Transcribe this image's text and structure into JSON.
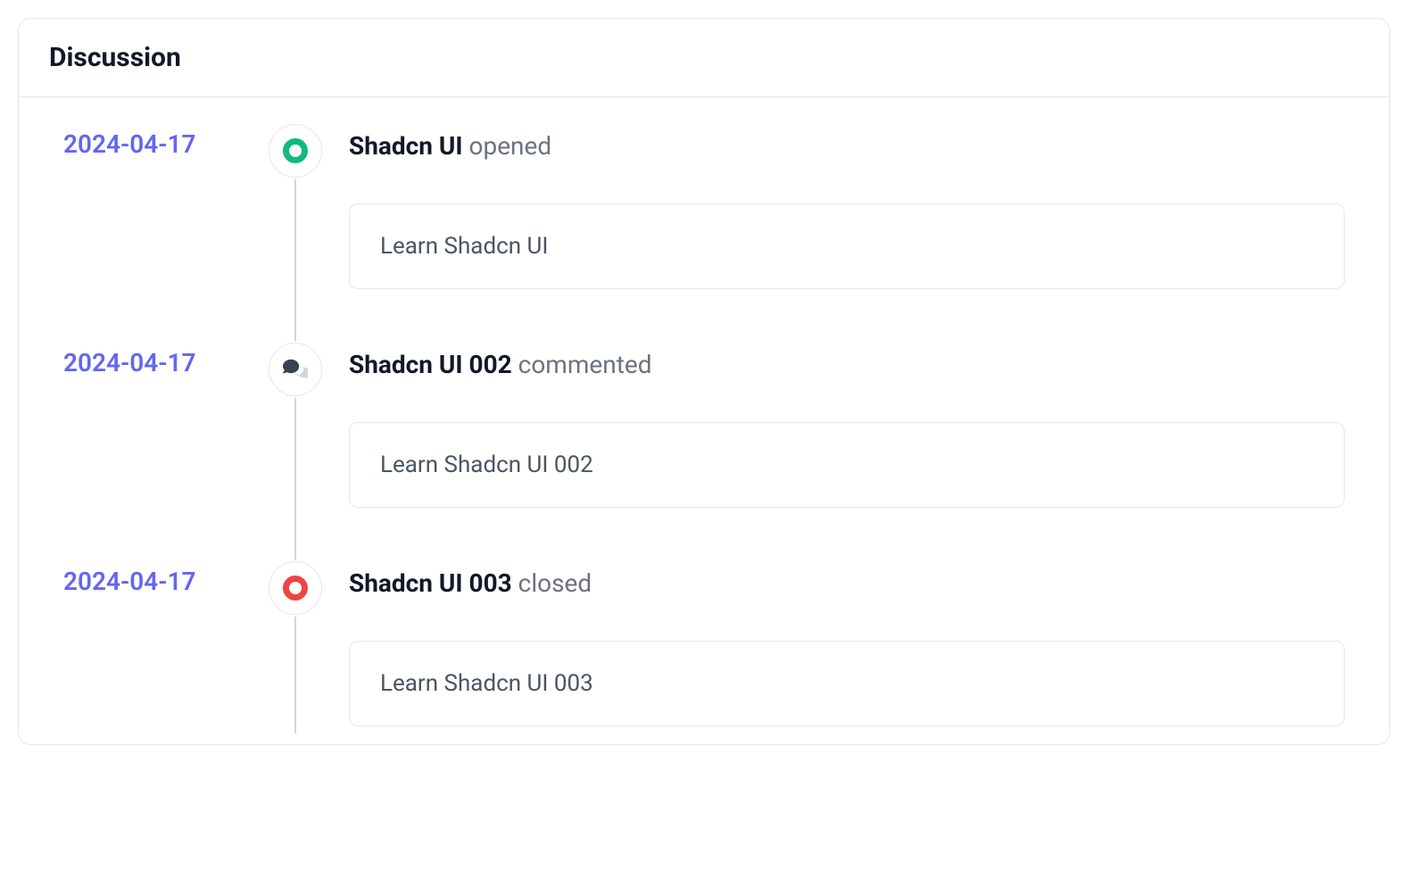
{
  "card": {
    "title": "Discussion"
  },
  "timeline": {
    "items": [
      {
        "date": "2024-04-17",
        "author": "Shadcn UI",
        "action": "opened",
        "body": "Learn Shadcn UI",
        "icon": "open"
      },
      {
        "date": "2024-04-17",
        "author": "Shadcn UI 002",
        "action": "commented",
        "body": "Learn Shadcn UI 002",
        "icon": "comment"
      },
      {
        "date": "2024-04-17",
        "author": "Shadcn UI 003",
        "action": "closed",
        "body": "Learn Shadcn UI 003",
        "icon": "closed"
      }
    ]
  }
}
